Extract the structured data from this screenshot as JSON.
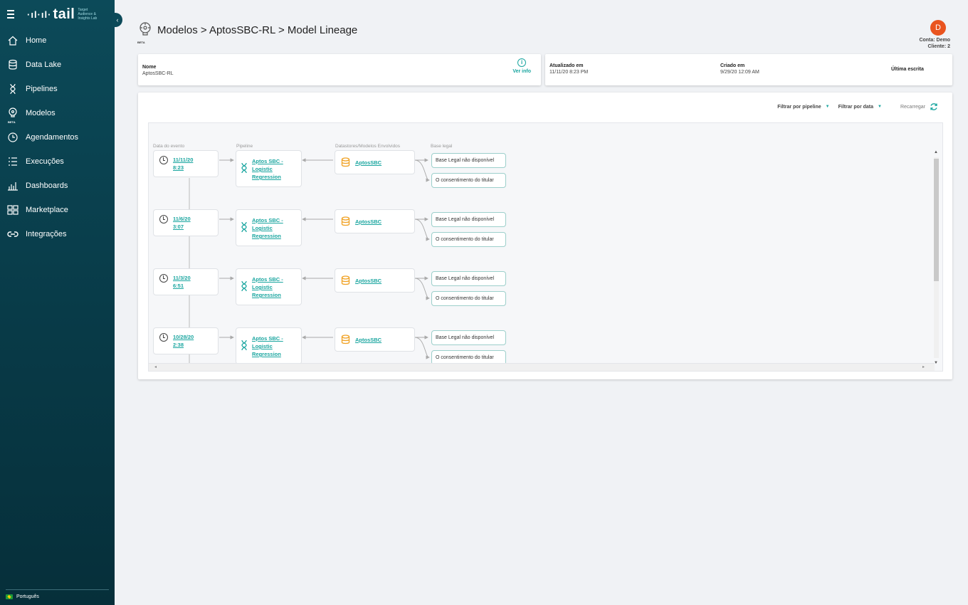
{
  "sidebar": {
    "logo": {
      "mark": "·ıl·ıl·",
      "word": "tail",
      "tagline": "Target Audience & Insights Lab"
    },
    "collapse_glyph": "‹",
    "items": [
      {
        "label": "Home",
        "icon": "home-icon"
      },
      {
        "label": "Data Lake",
        "icon": "database-icon"
      },
      {
        "label": "Pipelines",
        "icon": "dna-icon"
      },
      {
        "label": "Modelos",
        "icon": "model-brain-icon",
        "badge": "BETA"
      },
      {
        "label": "Agendamentos",
        "icon": "clock-icon"
      },
      {
        "label": "Execuções",
        "icon": "list-icon"
      },
      {
        "label": "Dashboards",
        "icon": "bar-chart-icon"
      },
      {
        "label": "Marketplace",
        "icon": "grid-icon"
      },
      {
        "label": "Integrações",
        "icon": "link-icon"
      }
    ],
    "language": "Português"
  },
  "header": {
    "breadcrumb": "Modelos > AptosSBC-RL > Model Lineage",
    "beta": "BETA"
  },
  "account": {
    "avatar_letter": "D",
    "line1": "Conta: Demo",
    "line2": "Cliente: 2"
  },
  "info": {
    "name_label": "Nome",
    "name_value": "AptosSBC-RL",
    "info_icon_glyph": "i",
    "info_button": "Ver info",
    "updated_label": "Atualizado em",
    "updated_value": "11/11/20 8:23 PM",
    "created_label": "Criado em",
    "created_value": "9/29/20 12:09 AM",
    "last_write_label": "Última escrita"
  },
  "lineage": {
    "filters": {
      "pipeline": "Filtrar por pipeline",
      "date": "Filtrar por data",
      "reload": "Recarregar"
    },
    "columns": [
      "Data do evento",
      "Pipeline",
      "Datastores/Modelos Envolvidos",
      "Base legal"
    ],
    "rows": [
      {
        "date": "11/11/20",
        "time": "8:23",
        "pipeline": [
          "Aptos SBC -",
          "Logistic",
          "Regression"
        ],
        "datastore": "AptosSBC",
        "legal": [
          "Base Legal não disponível",
          "O consentimento do titular"
        ]
      },
      {
        "date": "11/6/20",
        "time": "3:07",
        "pipeline": [
          "Aptos SBC -",
          "Logistic",
          "Regression"
        ],
        "datastore": "AptosSBC",
        "legal": [
          "Base Legal não disponível",
          "O consentimento do titular"
        ]
      },
      {
        "date": "11/3/20",
        "time": "6:51",
        "pipeline": [
          "Aptos SBC -",
          "Logistic",
          "Regression"
        ],
        "datastore": "AptosSBC",
        "legal": [
          "Base Legal não disponível",
          "O consentimento do titular"
        ]
      },
      {
        "date": "10/28/20",
        "time": "2:38",
        "pipeline": [
          "Aptos SBC -",
          "Logistic",
          "Regression"
        ],
        "datastore": "AptosSBC",
        "legal": [
          "Base Legal não disponível",
          "O consentimento do titular"
        ]
      }
    ]
  },
  "colors": {
    "accent": "#1ba6a0",
    "sidebar": "#0c4a59",
    "avatar": "#e9541f",
    "datastore": "#f0a020"
  }
}
